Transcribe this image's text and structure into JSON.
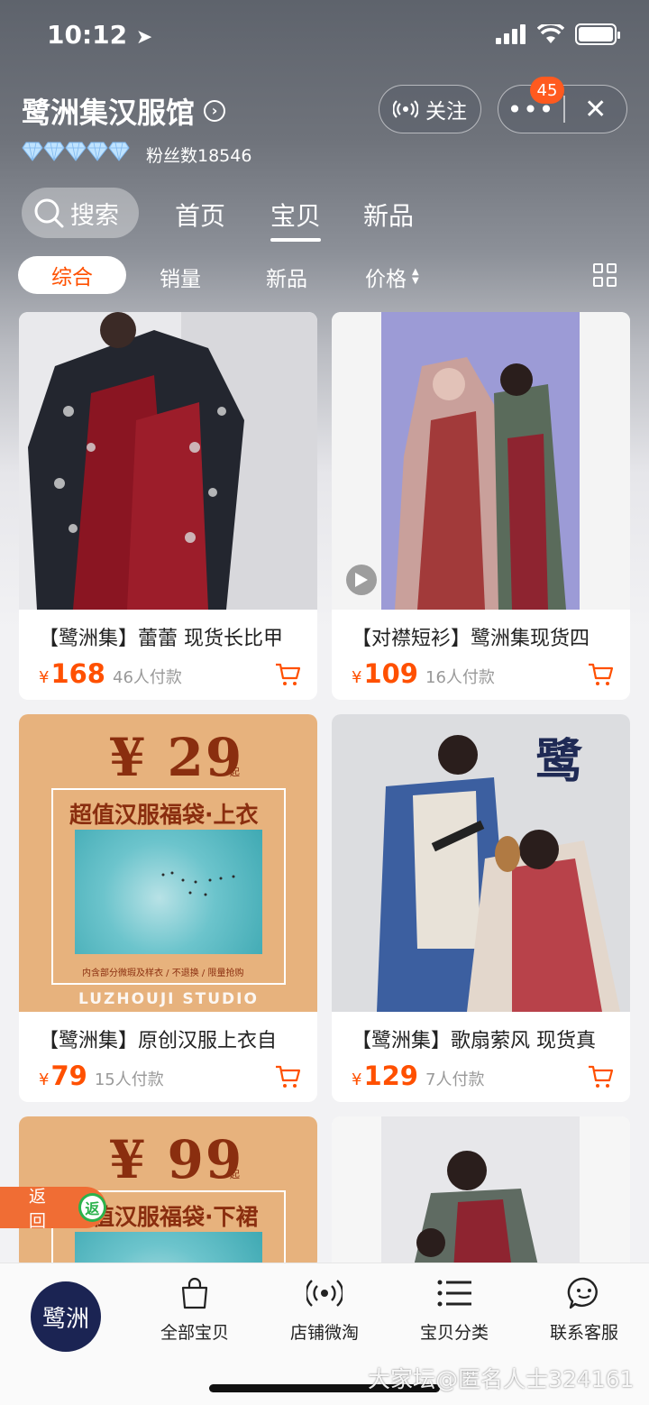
{
  "status_bar": {
    "time": "10:12",
    "battery_level": 1.0
  },
  "shop": {
    "name": "鹭洲集汉服馆",
    "diamond_count": 5,
    "fans_label": "粉丝数18546",
    "follow_label": "关注",
    "more_icon": "more-dots-icon",
    "close_icon": "close-icon",
    "notification_badge": "45"
  },
  "nav": {
    "search_label": "搜索",
    "tabs": [
      "首页",
      "宝贝",
      "新品"
    ],
    "active_tab": "宝贝"
  },
  "sort": {
    "items": [
      "综合",
      "销量",
      "新品",
      "价格"
    ],
    "active": "综合"
  },
  "products": [
    {
      "title": "【鹭洲集】蕾蕾 现货长比甲",
      "currency": "¥",
      "price": "168",
      "sold": "46人付款"
    },
    {
      "title": "【对襟短衫】鹭洲集现货四",
      "currency": "¥",
      "price": "109",
      "sold": "16人付款"
    },
    {
      "title": "【鹭洲集】原创汉服上衣自",
      "currency": "¥",
      "price": "79",
      "sold": "15人付款",
      "promo": {
        "price": "¥ 29",
        "qi": "起",
        "headline": "超值汉服福袋·上衣",
        "note": "内含部分微瑕及样衣 / 不退换 / 限量抢购",
        "studio": "LUZHOUJI STUDIO"
      }
    },
    {
      "title": "【鹭洲集】歌扇萦风 现货真",
      "currency": "¥",
      "price": "129",
      "sold": "7人付款"
    },
    {
      "promo": {
        "price": "¥ 99",
        "qi": "起",
        "headline": "超值汉服福袋·下裙"
      }
    }
  ],
  "back_button": {
    "label": "返回",
    "logo_text": "返"
  },
  "bottom_bar": {
    "logo_text": "鹭洲",
    "tabs": [
      {
        "label": "全部宝贝",
        "icon": "shopping-bag-icon"
      },
      {
        "label": "店铺微淘",
        "icon": "broadcast-icon"
      },
      {
        "label": "宝贝分类",
        "icon": "list-icon"
      },
      {
        "label": "联系客服",
        "icon": "chat-bubble-icon"
      }
    ]
  },
  "watermark": "大家坛@匿名人士324161",
  "colors": {
    "accent": "#ff5000",
    "promo_bg": "#e7b27d",
    "promo_text": "#8a2e0f",
    "back_button": "#f06d34"
  }
}
